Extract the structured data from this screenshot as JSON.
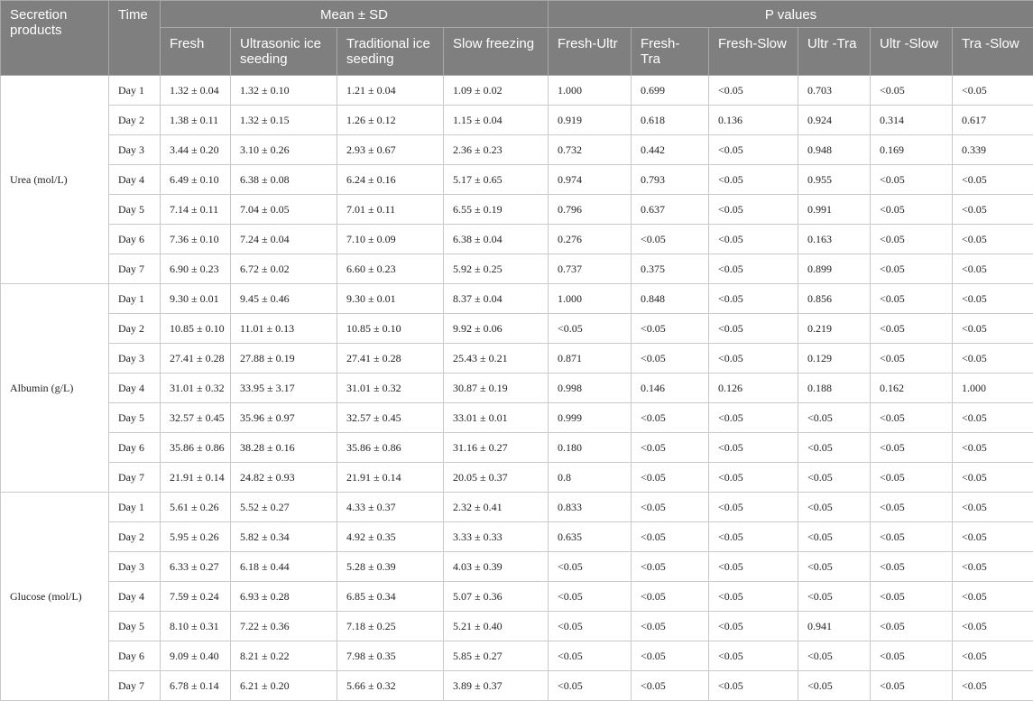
{
  "header": {
    "secretion_products": "Secretion products",
    "time": "Time",
    "mean_sd": "Mean ± SD",
    "p_values": "P values",
    "columns": [
      "Fresh",
      "Ultrasonic ice seeding",
      "Traditional ice seeding",
      "Slow freezing",
      "Fresh-Ultr",
      "Fresh-Tra",
      "Fresh-Slow",
      "Ultr -Tra",
      "Ultr -Slow",
      "Tra -Slow"
    ]
  },
  "groups": [
    {
      "product": "Urea (mol/L)",
      "rows": [
        [
          "Day 1",
          "1.32 ± 0.04",
          "1.32 ± 0.10",
          "1.21 ± 0.04",
          "1.09 ± 0.02",
          "1.000",
          "0.699",
          "<0.05",
          "0.703",
          "<0.05",
          "<0.05"
        ],
        [
          "Day 2",
          "1.38 ± 0.11",
          "1.32 ± 0.15",
          "1.26 ± 0.12",
          "1.15 ± 0.04",
          "0.919",
          "0.618",
          "0.136",
          "0.924",
          "0.314",
          "0.617"
        ],
        [
          "Day 3",
          "3.44 ± 0.20",
          "3.10 ± 0.26",
          "2.93 ± 0.67",
          "2.36 ± 0.23",
          "0.732",
          "0.442",
          "<0.05",
          "0.948",
          "0.169",
          "0.339"
        ],
        [
          "Day 4",
          "6.49 ± 0.10",
          "6.38 ± 0.08",
          "6.24 ± 0.16",
          "5.17 ± 0.65",
          "0.974",
          "0.793",
          "<0.05",
          "0.955",
          "<0.05",
          "<0.05"
        ],
        [
          "Day 5",
          "7.14 ± 0.11",
          "7.04 ± 0.05",
          "7.01 ± 0.11",
          "6.55 ± 0.19",
          "0.796",
          "0.637",
          "<0.05",
          "0.991",
          "<0.05",
          "<0.05"
        ],
        [
          "Day 6",
          "7.36 ± 0.10",
          "7.24 ± 0.04",
          "7.10 ± 0.09",
          "6.38 ± 0.04",
          "0.276",
          "<0.05",
          "<0.05",
          "0.163",
          "<0.05",
          "<0.05"
        ],
        [
          "Day 7",
          "6.90 ± 0.23",
          "6.72 ± 0.02",
          "6.60 ± 0.23",
          "5.92 ± 0.25",
          "0.737",
          "0.375",
          "<0.05",
          "0.899",
          "<0.05",
          "<0.05"
        ]
      ]
    },
    {
      "product": "Albumin (g/L)",
      "rows": [
        [
          "Day 1",
          "9.30 ± 0.01",
          "9.45 ± 0.46",
          "9.30 ± 0.01",
          "8.37 ± 0.04",
          "1.000",
          "0.848",
          "<0.05",
          "0.856",
          "<0.05",
          "<0.05"
        ],
        [
          "Day 2",
          "10.85 ± 0.10",
          "11.01 ± 0.13",
          "10.85 ± 0.10",
          "9.92 ± 0.06",
          "<0.05",
          "<0.05",
          "<0.05",
          "0.219",
          "<0.05",
          "<0.05"
        ],
        [
          "Day 3",
          "27.41 ± 0.28",
          "27.88 ± 0.19",
          "27.41 ± 0.28",
          "25.43 ± 0.21",
          "0.871",
          "<0.05",
          "<0.05",
          "0.129",
          "<0.05",
          "<0.05"
        ],
        [
          "Day 4",
          "31.01 ± 0.32",
          "33.95 ± 3.17",
          "31.01 ± 0.32",
          "30.87 ± 0.19",
          "0.998",
          "0.146",
          "0.126",
          "0.188",
          "0.162",
          "1.000"
        ],
        [
          "Day 5",
          "32.57 ± 0.45",
          "35.96 ± 0.97",
          "32.57 ± 0.45",
          "33.01 ± 0.01",
          "0.999",
          "<0.05",
          "<0.05",
          "<0.05",
          "<0.05",
          "<0.05"
        ],
        [
          "Day 6",
          "35.86 ± 0.86",
          "38.28 ± 0.16",
          "35.86 ± 0.86",
          "31.16 ± 0.27",
          "0.180",
          "<0.05",
          "<0.05",
          "<0.05",
          "<0.05",
          "<0.05"
        ],
        [
          "Day 7",
          "21.91 ± 0.14",
          "24.82 ± 0.93",
          "21.91 ± 0.14",
          "20.05 ± 0.37",
          "0.8",
          "<0.05",
          "<0.05",
          "<0.05",
          "<0.05",
          "<0.05"
        ]
      ]
    },
    {
      "product": "Glucose (mol/L)",
      "rows": [
        [
          "Day 1",
          "5.61 ± 0.26",
          "5.52 ± 0.27",
          "4.33 ± 0.37",
          "2.32 ± 0.41",
          "0.833",
          "<0.05",
          "<0.05",
          "<0.05",
          "<0.05",
          "<0.05"
        ],
        [
          "Day 2",
          "5.95 ± 0.26",
          "5.82 ± 0.34",
          "4.92 ± 0.35",
          "3.33 ± 0.33",
          "0.635",
          "<0.05",
          "<0.05",
          "<0.05",
          "<0.05",
          "<0.05"
        ],
        [
          "Day 3",
          "6.33 ± 0.27",
          "6.18 ± 0.44",
          "5.28 ± 0.39",
          "4.03 ± 0.39",
          "<0.05",
          "<0.05",
          "<0.05",
          "<0.05",
          "<0.05",
          "<0.05"
        ],
        [
          "Day 4",
          "7.59 ± 0.24",
          "6.93 ± 0.28",
          "6.85 ± 0.34",
          "5.07 ± 0.36",
          "<0.05",
          "<0.05",
          "<0.05",
          "<0.05",
          "<0.05",
          "<0.05"
        ],
        [
          "Day 5",
          "8.10 ± 0.31",
          "7.22 ± 0.36",
          "7.18 ± 0.25",
          "5.21 ± 0.40",
          "<0.05",
          "<0.05",
          "<0.05",
          "0.941",
          "<0.05",
          "<0.05"
        ],
        [
          "Day 6",
          "9.09 ± 0.40",
          "8.21 ± 0.22",
          "7.98 ± 0.35",
          "5.85 ± 0.27",
          "<0.05",
          "<0.05",
          "<0.05",
          "<0.05",
          "<0.05",
          "<0.05"
        ],
        [
          "Day 7",
          "6.78 ± 0.14",
          "6.21 ± 0.20",
          "5.66 ± 0.32",
          "3.89 ± 0.37",
          "<0.05",
          "<0.05",
          "<0.05",
          "<0.05",
          "<0.05",
          "<0.05"
        ]
      ]
    }
  ]
}
